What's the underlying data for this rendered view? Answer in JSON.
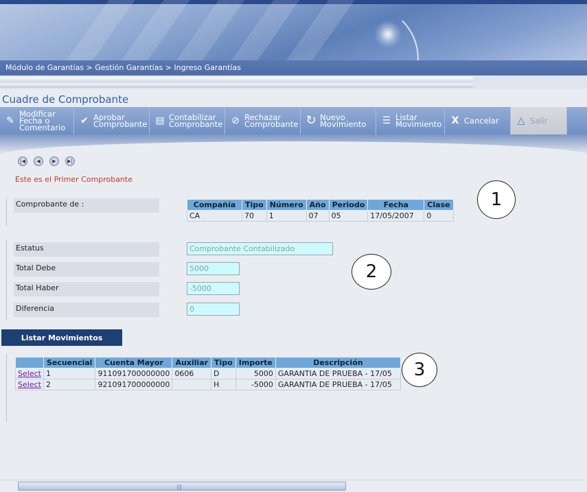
{
  "breadcrumb": "Módulo de Garantías > Gestión Garantías > Ingreso Garantías",
  "page_title": "Cuadre de Comprobante",
  "toolbar": [
    {
      "line1": "Modificar",
      "line2": "Fecha o",
      "line3": "Comentario",
      "icon": "edit-icon"
    },
    {
      "line1": "Aprobar",
      "line2": "Comprobante",
      "icon": "approve-icon"
    },
    {
      "line1": "Contabilizar",
      "line2": "Comprobante",
      "icon": "ledger-icon"
    },
    {
      "line1": "Rechazar",
      "line2": "Comprobante",
      "icon": "reject-icon"
    },
    {
      "line1": "Nuevo",
      "line2": "Movimiento",
      "icon": "refresh-icon"
    },
    {
      "line1": "Listar",
      "line2": "Movimiento",
      "icon": "list-icon"
    },
    {
      "line1": "Cancelar",
      "icon": "x-icon"
    },
    {
      "line1": "Salir",
      "icon": "exit-icon"
    }
  ],
  "nav_glyphs": [
    "|◀",
    "◀",
    "▶",
    "▶|"
  ],
  "message": "Este es el Primer Comprobante",
  "comprobante": {
    "label": "Comprobante de :",
    "headers": [
      "Compañía",
      "Tipo",
      "Número",
      "Año",
      "Periodo",
      "Fecha",
      "Clase"
    ],
    "row": [
      "CA",
      "70",
      "1",
      "07",
      "05",
      "17/05/2007",
      "0"
    ]
  },
  "fields": {
    "estatus_label": "Estatus",
    "estatus_value": "Comprobante Contabilizado",
    "debe_label": "Total Debe",
    "debe_value": "5000",
    "haber_label": "Total Haber",
    "haber_value": "-5000",
    "diferencia_label": "Diferencia",
    "diferencia_value": "0"
  },
  "listar_movimientos_label": "Listar Movimientos",
  "movimientos": {
    "headers": [
      "",
      "Secuencial",
      "Cuenta Mayor",
      "Auxiliar",
      "Tipo",
      "Importe",
      "Descripción"
    ],
    "rows": [
      {
        "link": "Select",
        "sec": "1",
        "cuenta": "911091700000000",
        "aux": "0606",
        "tipo": "D",
        "importe": "5000",
        "desc": "GARANTIA DE PRUEBA - 17/05"
      },
      {
        "link": "Select",
        "sec": "2",
        "cuenta": "921091700000000",
        "aux": "",
        "tipo": "H",
        "importe": "-5000",
        "desc": "GARANTIA DE PRUEBA - 17/05"
      }
    ]
  },
  "annotations": [
    "1",
    "2",
    "3"
  ],
  "scroll_grip": "|||"
}
